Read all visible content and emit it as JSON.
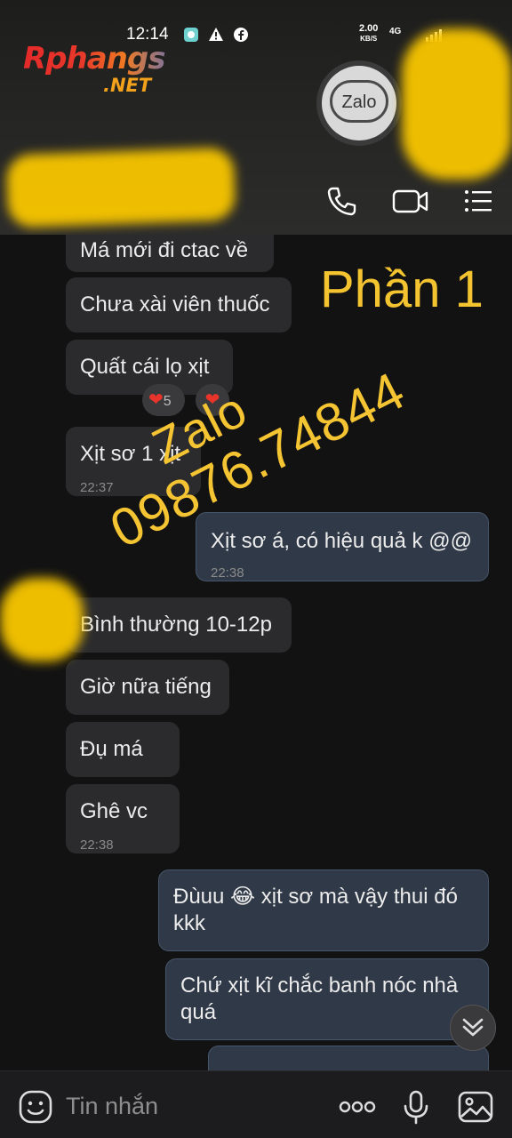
{
  "status_bar": {
    "time": "12:14",
    "net_speed": "2.00",
    "net_unit": "KB/S",
    "network": "4G"
  },
  "watermark_site": {
    "brand": "Rphangs",
    "tld": ".NET"
  },
  "contact": {
    "avatar_label": "Zalo",
    "actions": [
      "phone-icon",
      "video-call-icon",
      "menu-icon"
    ]
  },
  "overlay": {
    "section_label": "Phần 1",
    "watermark_line1": "Zalo",
    "watermark_line2": "09876.74844"
  },
  "messages": [
    {
      "side": "in",
      "text": "Má mới đi ctac về"
    },
    {
      "side": "in",
      "text": "Chưa xài viên thuốc"
    },
    {
      "side": "in",
      "text": "Quất cái lọ xịt",
      "reactions": [
        {
          "emoji": "❤",
          "count": "5"
        },
        {
          "emoji": "❤"
        }
      ]
    },
    {
      "side": "in",
      "text": "Xịt sơ 1 xịt",
      "time": "22:37"
    },
    {
      "side": "out",
      "text": "Xịt sơ á, có hiệu quả k @@",
      "time": "22:38"
    },
    {
      "side": "in",
      "text": "Bình thường 10-12p"
    },
    {
      "side": "in",
      "text": "Giờ nữa tiếng"
    },
    {
      "side": "in",
      "text": "Đụ má"
    },
    {
      "side": "in",
      "text": "Ghê vc",
      "time": "22:38"
    },
    {
      "side": "out",
      "text": "Đùuu 😂 xịt sơ mà vậy thui đó kkk"
    },
    {
      "side": "out",
      "text": "Chứ xịt kĩ chắc banh nóc nhà quá"
    }
  ],
  "composer": {
    "placeholder": "Tin nhắn",
    "icons": [
      "emoji-icon",
      "more-icon",
      "microphone-icon",
      "image-icon"
    ]
  },
  "colors": {
    "background": "#121212",
    "incoming_bubble": "#2b2b2d",
    "outgoing_bubble": "#303947",
    "overlay_text": "#f4c430",
    "heart": "#e8342a"
  }
}
